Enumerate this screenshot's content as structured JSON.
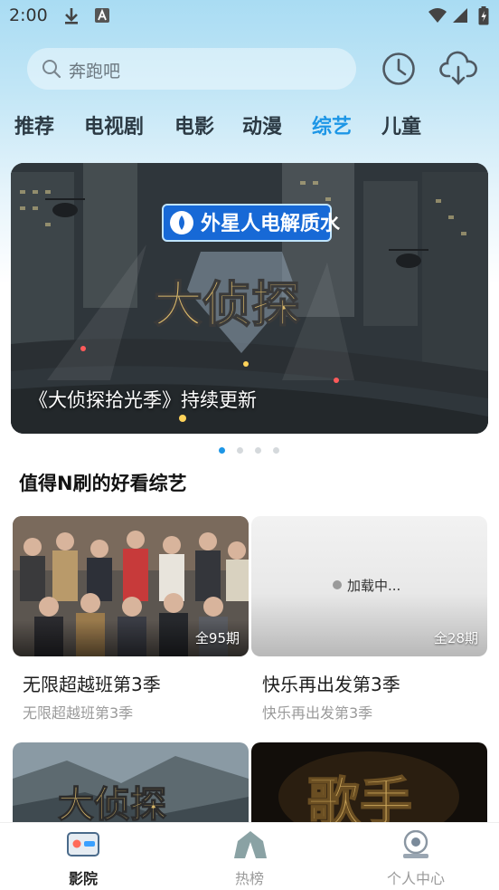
{
  "status_bar": {
    "time": "2:00"
  },
  "search": {
    "placeholder": "奔跑吧"
  },
  "tabs": [
    {
      "label": "推荐",
      "active": false
    },
    {
      "label": "电视剧",
      "active": false
    },
    {
      "label": "电影",
      "active": false
    },
    {
      "label": "动漫",
      "active": false
    },
    {
      "label": "综艺",
      "active": true
    },
    {
      "label": "儿童",
      "active": false
    }
  ],
  "banner": {
    "caption": "《大侦探拾光季》持续更新",
    "logo_text": "大侦探",
    "sponsor_text": "外星人电解质水",
    "page_count": 4,
    "active_page": 1
  },
  "section": {
    "title": "值得N刷的好看综艺"
  },
  "cards": [
    {
      "title": "无限超越班第3季",
      "subtitle": "无限超越班第3季",
      "episodes": "全95期"
    },
    {
      "title": "快乐再出发第3季",
      "subtitle": "快乐再出发第3季",
      "episodes": "全28期",
      "loading": "加载中..."
    },
    {
      "logo_text": "大侦探"
    },
    {
      "logo_text": "歌手"
    }
  ],
  "bottom_nav": [
    {
      "label": "影院",
      "icon": "cinema-icon",
      "active": true
    },
    {
      "label": "热榜",
      "icon": "crown-icon",
      "active": false
    },
    {
      "label": "个人中心",
      "icon": "profile-icon",
      "active": false
    }
  ],
  "colors": {
    "accent": "#1d96e6",
    "header_bg": "#a9dcf3"
  }
}
